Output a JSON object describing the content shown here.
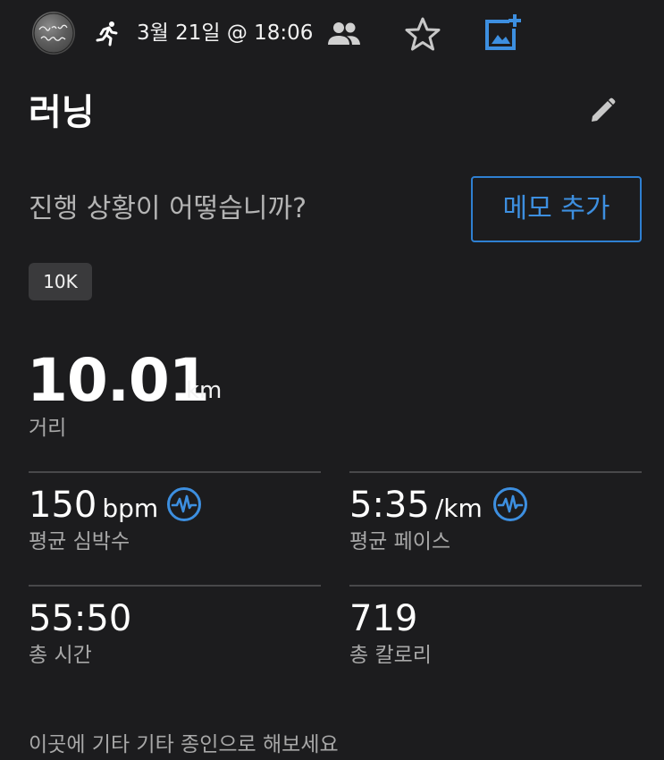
{
  "header": {
    "avatar_icon": "profile-photo",
    "activity_icon": "runner-icon",
    "date_time": "3월 21일 @ 18:06",
    "privacy_icon": "people-icon",
    "favorite_icon": "star-outline-icon",
    "add_photo_icon": "add-photo-icon"
  },
  "activity": {
    "title": "러닝",
    "edit_icon": "pencil-icon"
  },
  "prompt": {
    "question": "진행 상황이 어떻습니까?",
    "memo_button": "메모 추가"
  },
  "tag": "10K",
  "distance": {
    "value": "10.01",
    "unit": "km",
    "label": "거리"
  },
  "stats": {
    "heart_rate": {
      "value": "150",
      "unit": "bpm",
      "label": "평균 심박수",
      "icon": "heart-rate-chart-icon"
    },
    "pace": {
      "value": "5:35",
      "unit": "/km",
      "label": "평균 페이스",
      "icon": "pace-chart-icon"
    },
    "time": {
      "value": "55:50",
      "label": "총 시간"
    },
    "calories": {
      "value": "719",
      "label": "총 칼로리"
    }
  },
  "bottom_hint": "이곳에 기타 기타 종인으로 해보세요",
  "colors": {
    "background": "#1c1c1e",
    "accent": "#2f80d2",
    "secondary_text": "#a8a8a8",
    "divider": "#48484a"
  }
}
